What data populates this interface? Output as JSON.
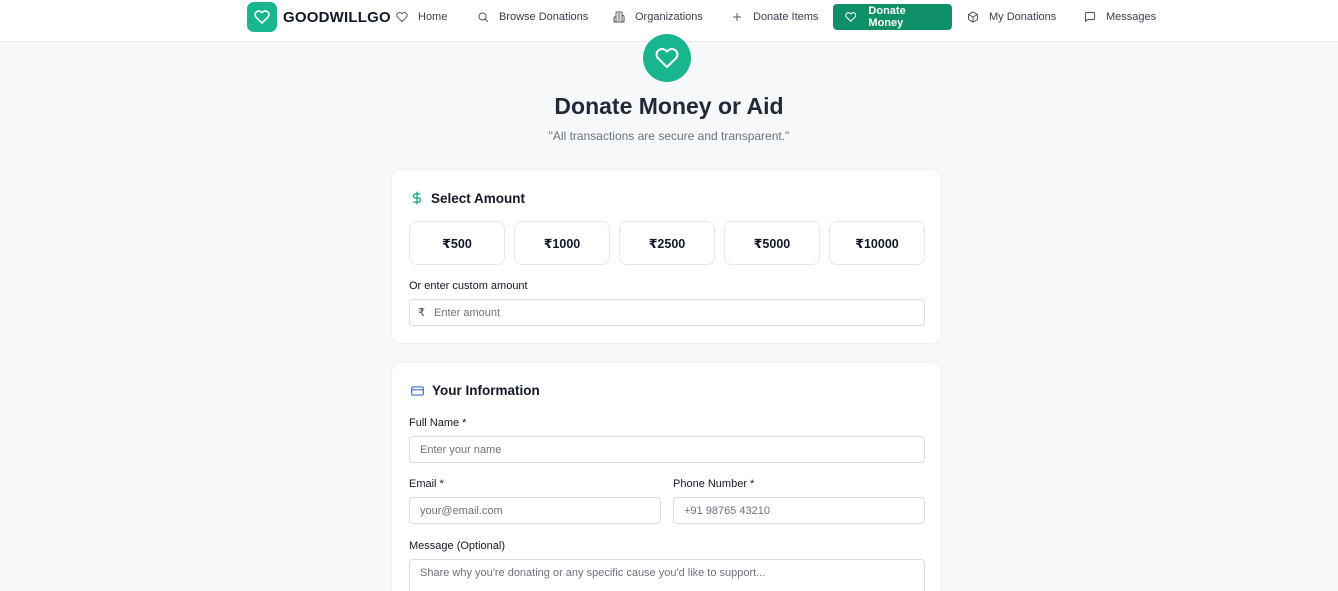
{
  "nav": {
    "brand": "GOODWILLGO",
    "items": [
      {
        "label": "Home",
        "icon": "heart-icon"
      },
      {
        "label": "Browse Donations",
        "icon": "search-icon"
      },
      {
        "label": "Organizations",
        "icon": "building-icon"
      },
      {
        "label": "Donate Items",
        "icon": "plus-icon"
      },
      {
        "label": "Donate Money",
        "icon": "heart-icon",
        "active": true
      },
      {
        "label": "My Donations",
        "icon": "box-icon"
      },
      {
        "label": "Messages",
        "icon": "message-icon"
      }
    ]
  },
  "hero": {
    "title": "Donate Money or Aid",
    "subtitle": "\"All transactions are secure and transparent.\""
  },
  "amount": {
    "heading": "Select Amount",
    "presets": [
      "₹500",
      "₹1000",
      "₹2500",
      "₹5000",
      "₹10000"
    ],
    "custom_label": "Or enter custom amount",
    "custom_prefix": "₹",
    "custom_placeholder": "Enter amount"
  },
  "info": {
    "heading": "Your Information",
    "name_label": "Full Name *",
    "name_placeholder": "Enter your name",
    "email_label": "Email *",
    "email_placeholder": "your@email.com",
    "phone_label": "Phone Number *",
    "phone_placeholder": "+91 98765 43210",
    "message_label": "Message (Optional)",
    "message_placeholder": "Share why you're donating or any specific cause you'd like to support..."
  },
  "colors": {
    "brand": "#19b58f",
    "active_nav": "#0f8f68",
    "card_icon_blue": "#3b6fd8",
    "dollar_green": "#16a37a"
  }
}
